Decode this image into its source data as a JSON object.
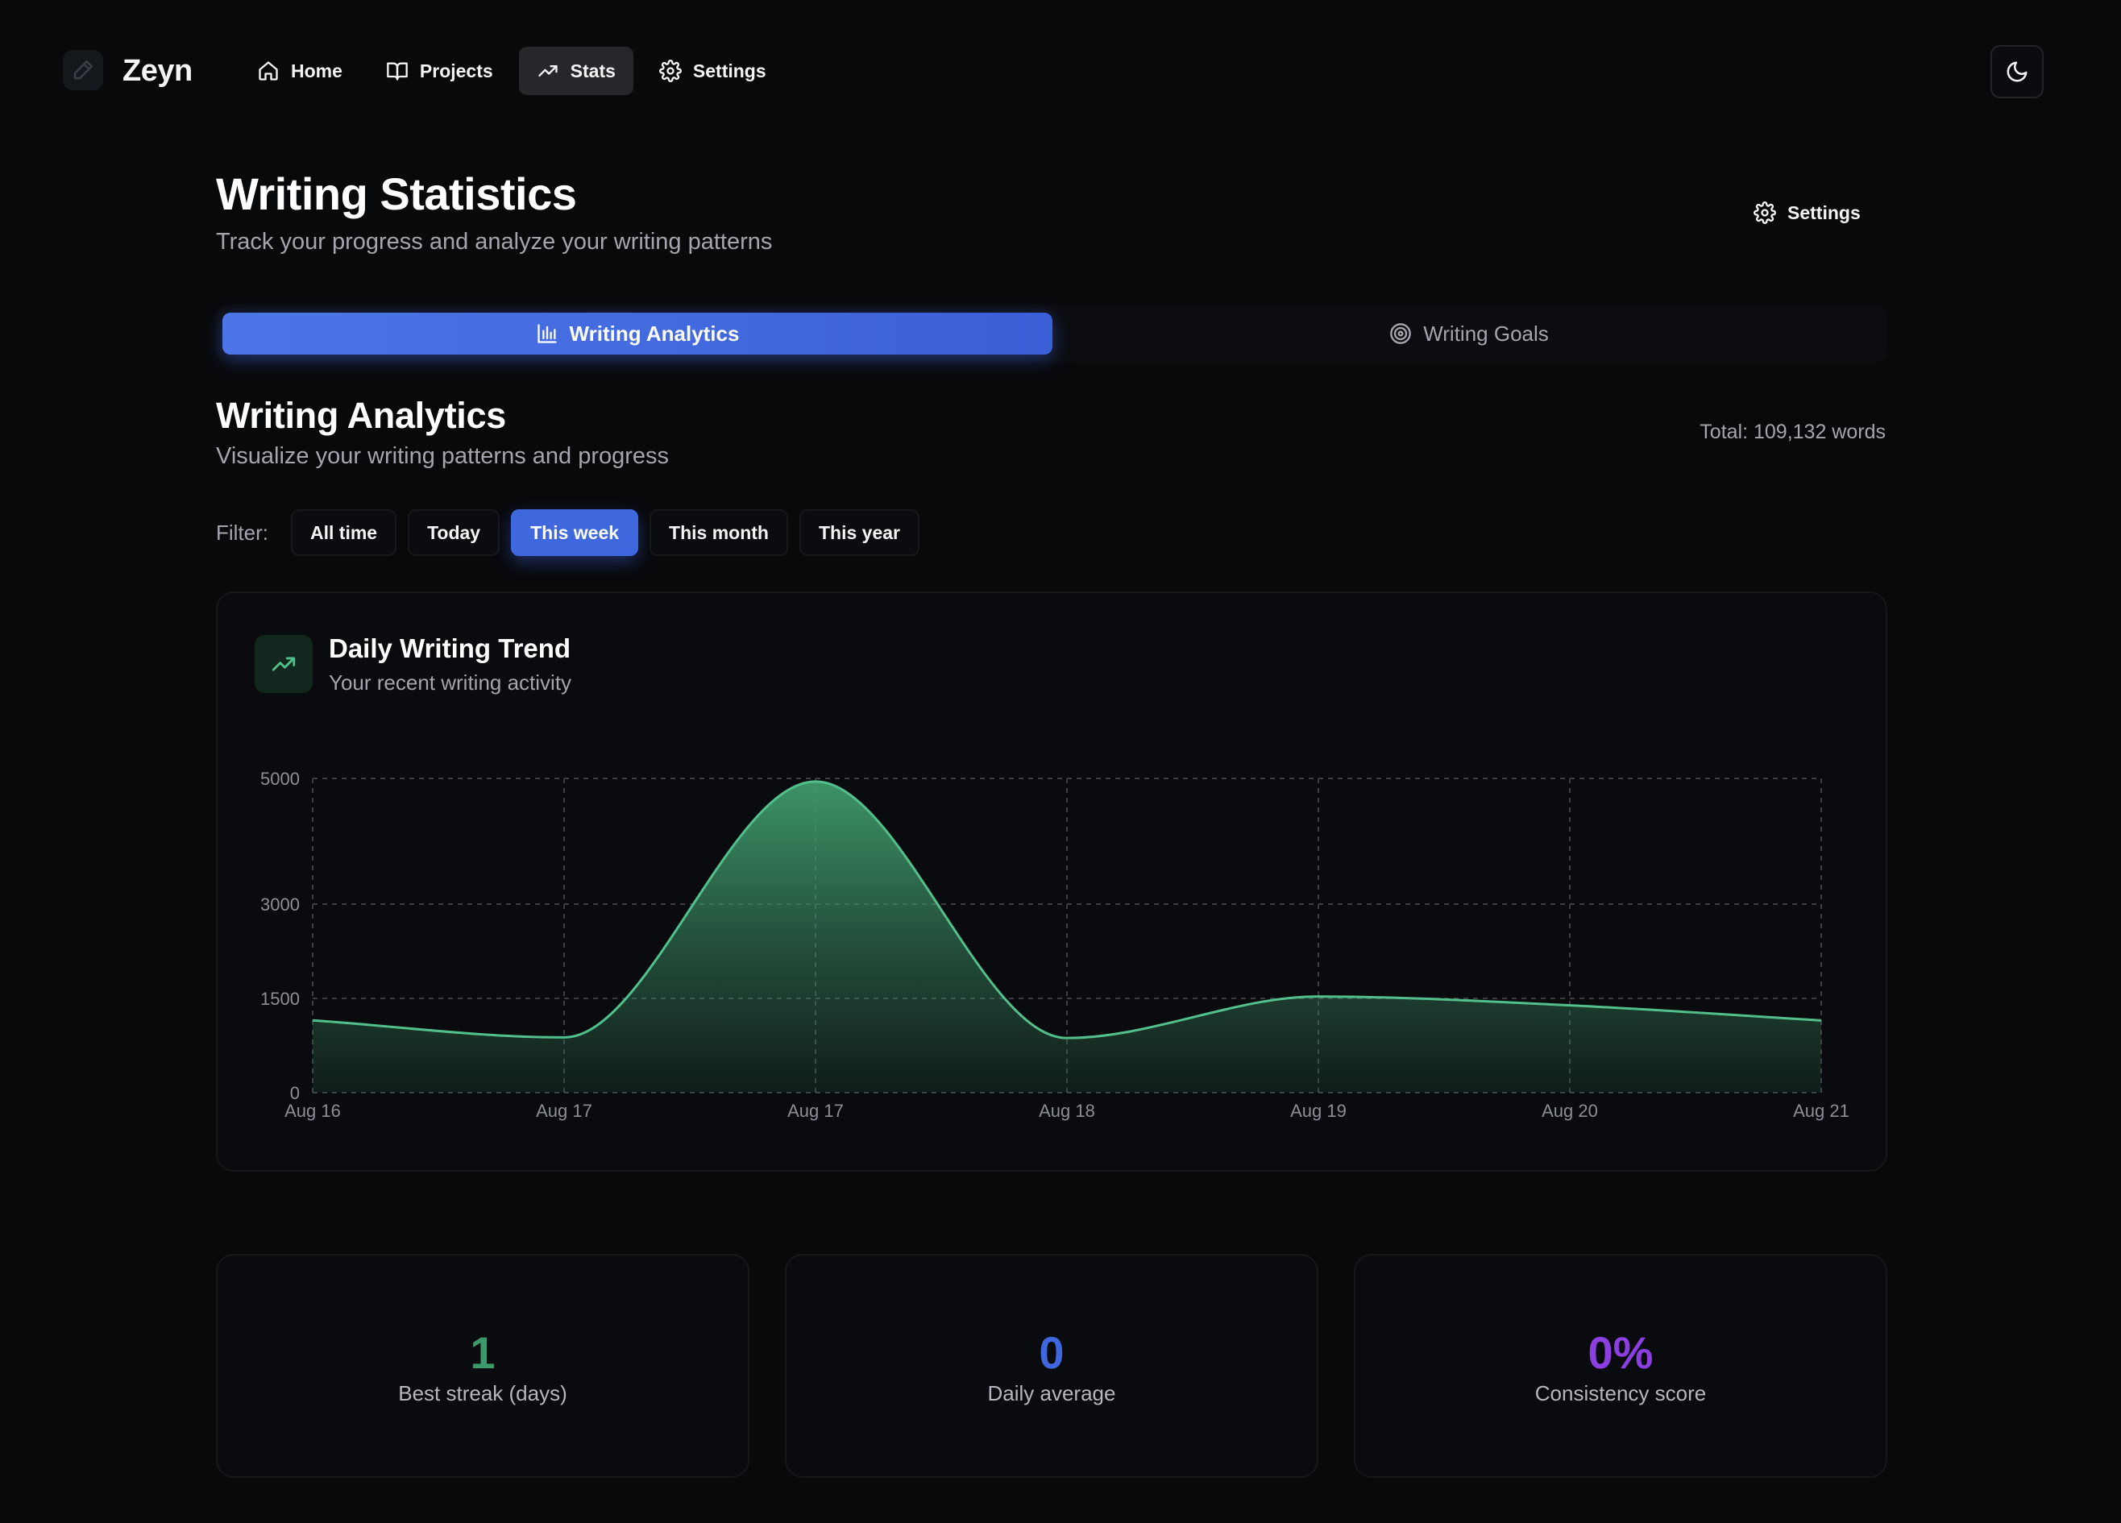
{
  "app": {
    "brand": "Zeyn",
    "nav": [
      {
        "label": "Home",
        "icon": "home-icon"
      },
      {
        "label": "Projects",
        "icon": "book-icon"
      },
      {
        "label": "Stats",
        "icon": "trending-up-icon",
        "active": true
      },
      {
        "label": "Settings",
        "icon": "gear-icon"
      }
    ],
    "theme_toggle_icon": "moon-icon"
  },
  "page": {
    "title": "Writing Statistics",
    "subtitle": "Track your progress and analyze your writing patterns",
    "settings_label": "Settings"
  },
  "tabs": [
    {
      "label": "Writing Analytics",
      "icon": "bar-chart-icon",
      "active": true
    },
    {
      "label": "Writing Goals",
      "icon": "target-icon",
      "active": false
    }
  ],
  "analytics": {
    "title": "Writing Analytics",
    "subtitle": "Visualize your writing patterns and progress",
    "total": "Total: 109,132 words",
    "filter_label": "Filter:",
    "filters": [
      {
        "label": "All time",
        "active": false
      },
      {
        "label": "Today",
        "active": false
      },
      {
        "label": "This week",
        "active": true
      },
      {
        "label": "This month",
        "active": false
      },
      {
        "label": "This year",
        "active": false
      }
    ]
  },
  "trend_card": {
    "title": "Daily Writing Trend",
    "subtitle": "Your recent writing activity"
  },
  "chart_data": {
    "type": "area",
    "title": "",
    "xlabel": "",
    "ylabel": "",
    "categories": [
      "Aug 16",
      "Aug 17",
      "Aug 17",
      "Aug 18",
      "Aug 19",
      "Aug 20",
      "Aug 21"
    ],
    "values": [
      1150,
      880,
      4950,
      870,
      1530,
      1390,
      1150
    ],
    "y_ticks": [
      0,
      1500,
      3000,
      5000
    ],
    "ylim": [
      0,
      5000
    ],
    "grid": true,
    "colors": {
      "line": "#52c08a",
      "fill": "#3f9a6c"
    }
  },
  "stats": [
    {
      "value": "1",
      "label": "Best streak (days)",
      "color": "#3a9a6a"
    },
    {
      "value": "0",
      "label": "Daily average",
      "color": "#3f68de"
    },
    {
      "value": "0%",
      "label": "Consistency score",
      "color": "#8b3fe0"
    }
  ]
}
